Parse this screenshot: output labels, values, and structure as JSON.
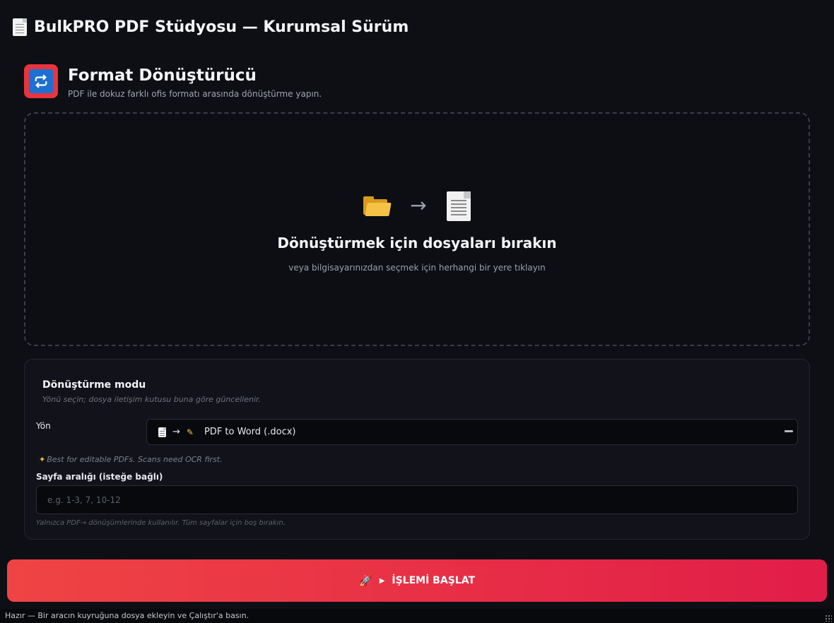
{
  "app": {
    "title": "BulkPRO PDF Stüdyosu — Kurumsal Sürüm"
  },
  "tool": {
    "title": "Format Dönüştürücü",
    "subtitle": "PDF ile dokuz farklı ofis formatı arasında dönüştürme yapın.",
    "icon": "repeat-icon",
    "icon_bg": "#e8343f",
    "icon_inner": "#1d6fd2"
  },
  "dropzone": {
    "title": "Dönüştürmek için dosyaları bırakın",
    "subtitle": "veya bilgisayarınızdan seçmek için herhangi bir yere tıklayın",
    "icons": [
      "folder-icon",
      "arrow-right-icon",
      "document-icon"
    ]
  },
  "mode_panel": {
    "title": "Dönüştürme modu",
    "subtitle": "Yönü seçin; dosya iletişim kutusu buna göre güncellenir.",
    "direction_label": "Yön",
    "direction_selected": "PDF to Word (.docx)",
    "direction_hint": "Best for editable PDFs. Scans need OCR first.",
    "range_label": "Sayfa aralığı (isteğe bağlı)",
    "range_value": "",
    "range_placeholder": "e.g. 1-3, 7, 10-12",
    "range_note": "Yalnızca PDF→ dönüşümlerinde kullanılır. Tüm sayfalar için boş bırakın."
  },
  "run_button": {
    "label": "İŞLEMİ BAŞLAT",
    "gradient": [
      "#ef4444",
      "#e11d48"
    ]
  },
  "status": {
    "text": "Hazır — Bir aracın kuyruğuna dosya ekleyin ve Çalıştır'a basın."
  }
}
